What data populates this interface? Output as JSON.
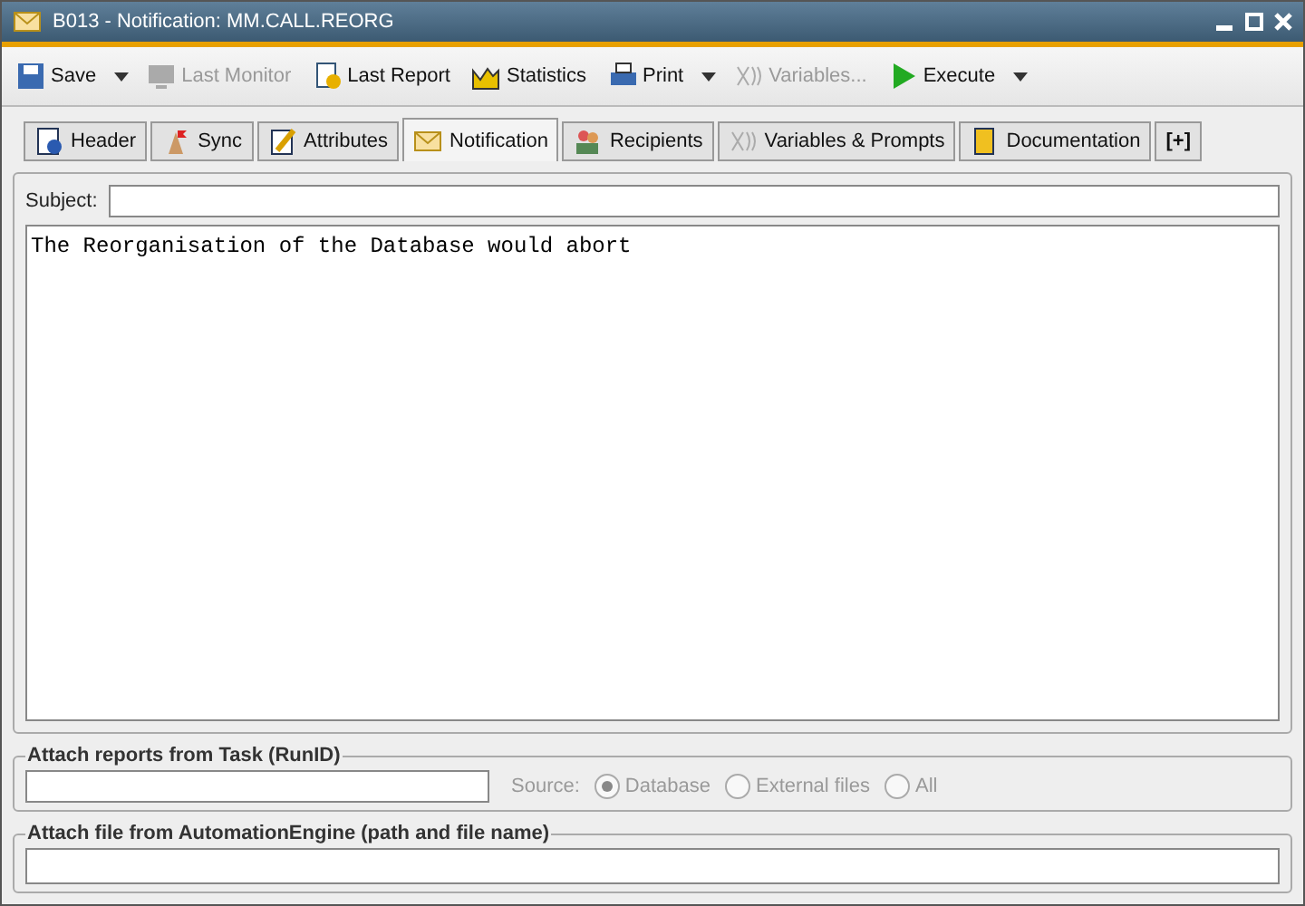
{
  "window": {
    "title": "B013 - Notification: MM.CALL.REORG"
  },
  "toolbar": [
    {
      "kind": "save",
      "label": "Save",
      "disabled": false,
      "dropdown": true
    },
    {
      "kind": "monitor",
      "label": "Last Monitor",
      "disabled": true,
      "dropdown": false
    },
    {
      "kind": "report",
      "label": "Last Report",
      "disabled": false,
      "dropdown": false
    },
    {
      "kind": "stats",
      "label": "Statistics",
      "disabled": false,
      "dropdown": false
    },
    {
      "kind": "print",
      "label": "Print",
      "disabled": false,
      "dropdown": true
    },
    {
      "kind": "variables",
      "label": "Variables...",
      "disabled": true,
      "dropdown": false
    },
    {
      "kind": "execute",
      "label": "Execute",
      "disabled": false,
      "dropdown": true
    }
  ],
  "tabs": [
    {
      "kind": "header",
      "label": "Header",
      "selected": false
    },
    {
      "kind": "sync",
      "label": "Sync",
      "selected": false
    },
    {
      "kind": "attributes",
      "label": "Attributes",
      "selected": false
    },
    {
      "kind": "notification",
      "label": "Notification",
      "selected": true
    },
    {
      "kind": "recipients",
      "label": "Recipients",
      "selected": false
    },
    {
      "kind": "variables",
      "label": "Variables & Prompts",
      "selected": false
    },
    {
      "kind": "documentation",
      "label": "Documentation",
      "selected": false
    },
    {
      "kind": "add",
      "label": "[+]",
      "selected": false
    }
  ],
  "subject": {
    "label": "Subject:"
  },
  "message": {
    "value": "The Reorganisation of the Database would abort"
  },
  "attach_reports": {
    "title": "Attach reports from Task (RunID)",
    "source_label": "Source:",
    "options": [
      {
        "label": "Database",
        "selected": true,
        "disabled": true
      },
      {
        "label": "External files",
        "selected": false,
        "disabled": true
      },
      {
        "label": "All",
        "selected": false,
        "disabled": true
      }
    ]
  },
  "attach_file": {
    "title": "Attach file from AutomationEngine (path and file name)"
  }
}
